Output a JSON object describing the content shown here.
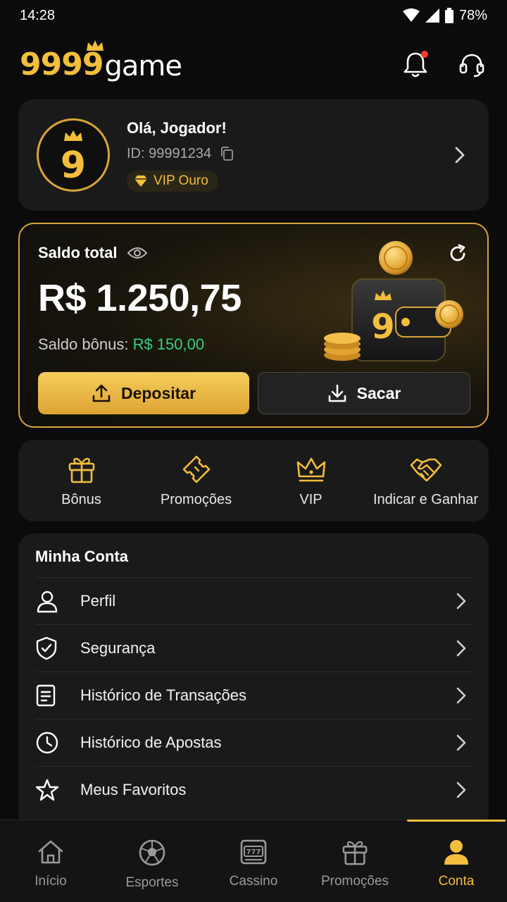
{
  "status_bar": {
    "time": "14:28",
    "battery": "78%"
  },
  "header": {
    "logo_digits": "9999",
    "logo_word": "game",
    "notification_dot_color": "#ff3b30"
  },
  "profile": {
    "greeting": "Olá, Jogador!",
    "player_id": "ID: 99991234",
    "vip_level": "VIP Ouro",
    "avatar_digit": "9"
  },
  "balance": {
    "label": "Saldo total",
    "amount": "R$ 1.250,75",
    "bonus_label": "Saldo bônus:",
    "bonus_value": "R$ 150,00",
    "deposit_label": "Depositar",
    "withdraw_label": "Sacar",
    "wallet_digit": "9"
  },
  "quick_actions": [
    {
      "label": "Bônus",
      "icon": "gift-icon"
    },
    {
      "label": "Promoções",
      "icon": "ticket-icon"
    },
    {
      "label": "VIP",
      "icon": "crown-icon"
    },
    {
      "label": "Indicar e Ganhar",
      "icon": "handshake-icon"
    }
  ],
  "account": {
    "title": "Minha Conta",
    "items": [
      {
        "label": "Perfil",
        "icon": "user-icon"
      },
      {
        "label": "Segurança",
        "icon": "shield-check-icon"
      },
      {
        "label": "Histórico de Transações",
        "icon": "document-icon"
      },
      {
        "label": "Histórico de Apostas",
        "icon": "clock-icon"
      },
      {
        "label": "Meus Favoritos",
        "icon": "star-icon"
      }
    ]
  },
  "bottom_nav": [
    {
      "label": "Início",
      "icon": "home-icon",
      "active": false
    },
    {
      "label": "Esportes",
      "icon": "soccer-ball-icon",
      "active": false
    },
    {
      "label": "Cassino",
      "icon": "slot-machine-icon",
      "active": false
    },
    {
      "label": "Promoções",
      "icon": "gift-icon",
      "active": false
    },
    {
      "label": "Conta",
      "icon": "account-icon",
      "active": true
    }
  ],
  "colors": {
    "gold": "#f2be3b",
    "bonus_green": "#35d07f",
    "background": "#0b0b0b",
    "card": "#1a1a1a"
  }
}
